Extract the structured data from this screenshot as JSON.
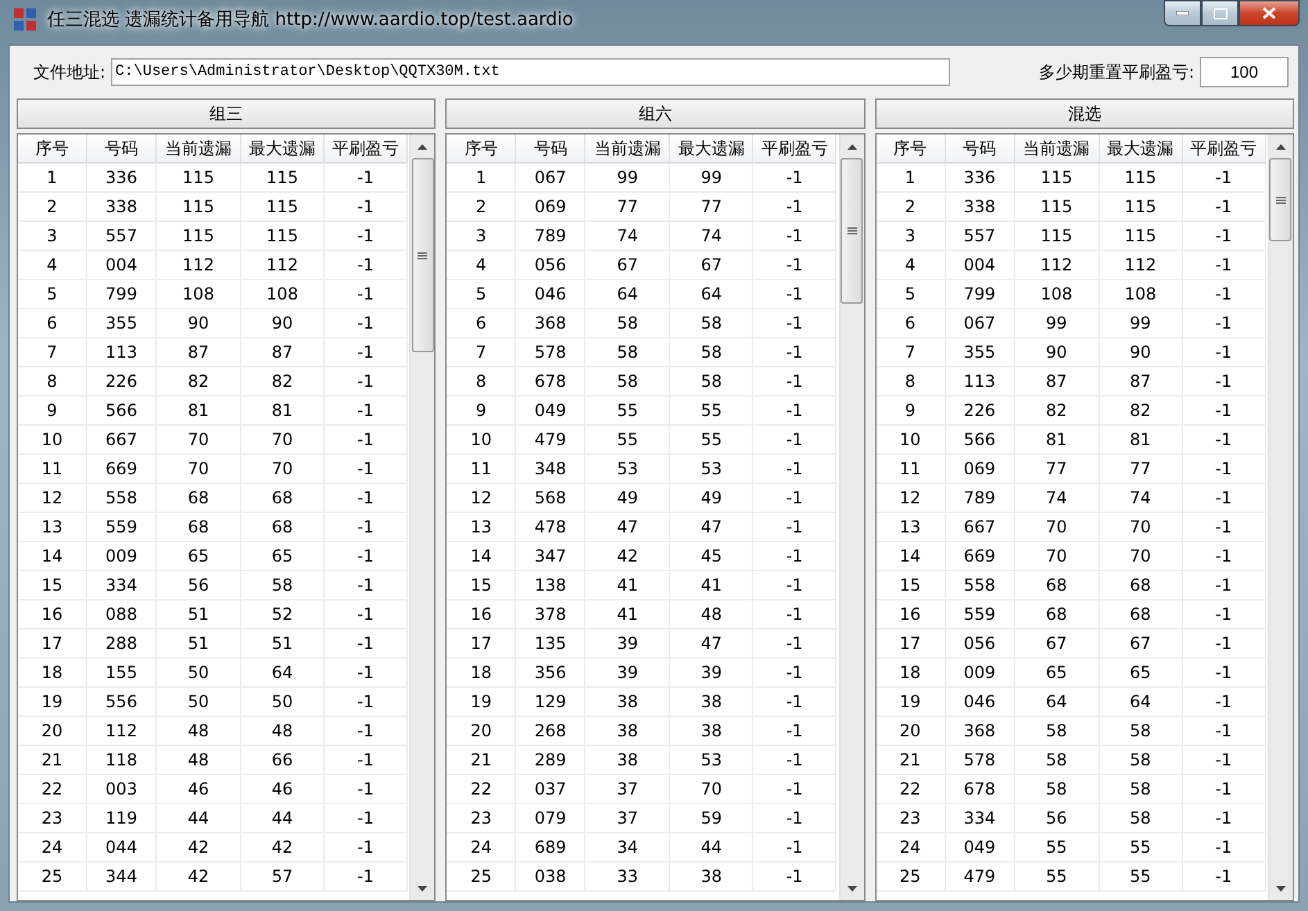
{
  "window": {
    "title": "任三混选 遗漏统计备用导航 http://www.aardio.top/test.aardio",
    "controls": [
      {
        "kind": "minimize"
      },
      {
        "kind": "maximize"
      },
      {
        "kind": "close"
      }
    ]
  },
  "file_path": {
    "label": "文件地址:",
    "value": "C:\\Users\\Administrator\\Desktop\\QQTX30M.txt"
  },
  "reset_period": {
    "label": "多少期重置平刷盈亏:",
    "value": "100"
  },
  "panels": [
    {
      "title": "组三",
      "columns": [
        "序号",
        "号码",
        "当前遗漏",
        "最大遗漏",
        "平刷盈亏"
      ],
      "rows": [
        [
          "1",
          "336",
          "115",
          "115",
          "-1"
        ],
        [
          "2",
          "338",
          "115",
          "115",
          "-1"
        ],
        [
          "3",
          "557",
          "115",
          "115",
          "-1"
        ],
        [
          "4",
          "004",
          "112",
          "112",
          "-1"
        ],
        [
          "5",
          "799",
          "108",
          "108",
          "-1"
        ],
        [
          "6",
          "355",
          "90",
          "90",
          "-1"
        ],
        [
          "7",
          "113",
          "87",
          "87",
          "-1"
        ],
        [
          "8",
          "226",
          "82",
          "82",
          "-1"
        ],
        [
          "9",
          "566",
          "81",
          "81",
          "-1"
        ],
        [
          "10",
          "667",
          "70",
          "70",
          "-1"
        ],
        [
          "11",
          "669",
          "70",
          "70",
          "-1"
        ],
        [
          "12",
          "558",
          "68",
          "68",
          "-1"
        ],
        [
          "13",
          "559",
          "68",
          "68",
          "-1"
        ],
        [
          "14",
          "009",
          "65",
          "65",
          "-1"
        ],
        [
          "15",
          "334",
          "56",
          "58",
          "-1"
        ],
        [
          "16",
          "088",
          "51",
          "52",
          "-1"
        ],
        [
          "17",
          "288",
          "51",
          "51",
          "-1"
        ],
        [
          "18",
          "155",
          "50",
          "64",
          "-1"
        ],
        [
          "19",
          "556",
          "50",
          "50",
          "-1"
        ],
        [
          "20",
          "112",
          "48",
          "48",
          "-1"
        ],
        [
          "21",
          "118",
          "48",
          "66",
          "-1"
        ],
        [
          "22",
          "003",
          "46",
          "46",
          "-1"
        ],
        [
          "23",
          "119",
          "44",
          "44",
          "-1"
        ],
        [
          "24",
          "044",
          "42",
          "42",
          "-1"
        ],
        [
          "25",
          "344",
          "42",
          "57",
          "-1"
        ]
      ]
    },
    {
      "title": "组六",
      "columns": [
        "序号",
        "号码",
        "当前遗漏",
        "最大遗漏",
        "平刷盈亏"
      ],
      "rows": [
        [
          "1",
          "067",
          "99",
          "99",
          "-1"
        ],
        [
          "2",
          "069",
          "77",
          "77",
          "-1"
        ],
        [
          "3",
          "789",
          "74",
          "74",
          "-1"
        ],
        [
          "4",
          "056",
          "67",
          "67",
          "-1"
        ],
        [
          "5",
          "046",
          "64",
          "64",
          "-1"
        ],
        [
          "6",
          "368",
          "58",
          "58",
          "-1"
        ],
        [
          "7",
          "578",
          "58",
          "58",
          "-1"
        ],
        [
          "8",
          "678",
          "58",
          "58",
          "-1"
        ],
        [
          "9",
          "049",
          "55",
          "55",
          "-1"
        ],
        [
          "10",
          "479",
          "55",
          "55",
          "-1"
        ],
        [
          "11",
          "348",
          "53",
          "53",
          "-1"
        ],
        [
          "12",
          "568",
          "49",
          "49",
          "-1"
        ],
        [
          "13",
          "478",
          "47",
          "47",
          "-1"
        ],
        [
          "14",
          "347",
          "42",
          "45",
          "-1"
        ],
        [
          "15",
          "138",
          "41",
          "41",
          "-1"
        ],
        [
          "16",
          "378",
          "41",
          "48",
          "-1"
        ],
        [
          "17",
          "135",
          "39",
          "47",
          "-1"
        ],
        [
          "18",
          "356",
          "39",
          "39",
          "-1"
        ],
        [
          "19",
          "129",
          "38",
          "38",
          "-1"
        ],
        [
          "20",
          "268",
          "38",
          "38",
          "-1"
        ],
        [
          "21",
          "289",
          "38",
          "53",
          "-1"
        ],
        [
          "22",
          "037",
          "37",
          "70",
          "-1"
        ],
        [
          "23",
          "079",
          "37",
          "59",
          "-1"
        ],
        [
          "24",
          "689",
          "34",
          "44",
          "-1"
        ],
        [
          "25",
          "038",
          "33",
          "38",
          "-1"
        ]
      ]
    },
    {
      "title": "混选",
      "columns": [
        "序号",
        "号码",
        "当前遗漏",
        "最大遗漏",
        "平刷盈亏"
      ],
      "rows": [
        [
          "1",
          "336",
          "115",
          "115",
          "-1"
        ],
        [
          "2",
          "338",
          "115",
          "115",
          "-1"
        ],
        [
          "3",
          "557",
          "115",
          "115",
          "-1"
        ],
        [
          "4",
          "004",
          "112",
          "112",
          "-1"
        ],
        [
          "5",
          "799",
          "108",
          "108",
          "-1"
        ],
        [
          "6",
          "067",
          "99",
          "99",
          "-1"
        ],
        [
          "7",
          "355",
          "90",
          "90",
          "-1"
        ],
        [
          "8",
          "113",
          "87",
          "87",
          "-1"
        ],
        [
          "9",
          "226",
          "82",
          "82",
          "-1"
        ],
        [
          "10",
          "566",
          "81",
          "81",
          "-1"
        ],
        [
          "11",
          "069",
          "77",
          "77",
          "-1"
        ],
        [
          "12",
          "789",
          "74",
          "74",
          "-1"
        ],
        [
          "13",
          "667",
          "70",
          "70",
          "-1"
        ],
        [
          "14",
          "669",
          "70",
          "70",
          "-1"
        ],
        [
          "15",
          "558",
          "68",
          "68",
          "-1"
        ],
        [
          "16",
          "559",
          "68",
          "68",
          "-1"
        ],
        [
          "17",
          "056",
          "67",
          "67",
          "-1"
        ],
        [
          "18",
          "009",
          "65",
          "65",
          "-1"
        ],
        [
          "19",
          "046",
          "64",
          "64",
          "-1"
        ],
        [
          "20",
          "368",
          "58",
          "58",
          "-1"
        ],
        [
          "21",
          "578",
          "58",
          "58",
          "-1"
        ],
        [
          "22",
          "678",
          "58",
          "58",
          "-1"
        ],
        [
          "23",
          "334",
          "56",
          "58",
          "-1"
        ],
        [
          "24",
          "049",
          "55",
          "55",
          "-1"
        ],
        [
          "25",
          "479",
          "55",
          "55",
          "-1"
        ]
      ]
    }
  ]
}
